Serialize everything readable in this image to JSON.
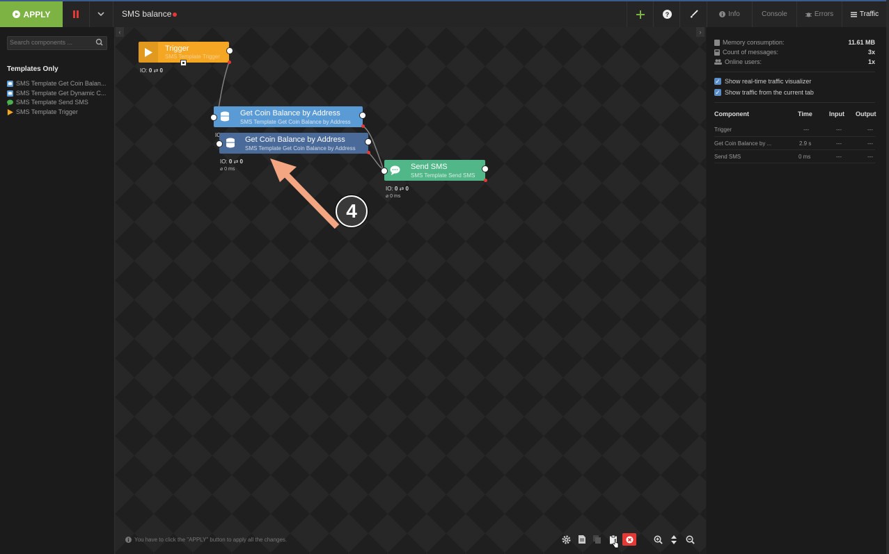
{
  "toolbar": {
    "apply_label": "APPLY",
    "flow_title": "SMS balance"
  },
  "right_tabs": [
    {
      "label": "Info",
      "icon": "info-icon"
    },
    {
      "label": "Console",
      "icon": ""
    },
    {
      "label": "Errors",
      "icon": "bug-icon"
    },
    {
      "label": "Traffic",
      "icon": "list-icon"
    }
  ],
  "sidebar": {
    "search_placeholder": "Search components ...",
    "heading": "Templates Only",
    "items": [
      {
        "label": "SMS Template Get Coin Balan...",
        "icon": "database-icon",
        "color": "#5b9bd5"
      },
      {
        "label": "SMS Template Get Dynamic C...",
        "icon": "database-icon",
        "color": "#5b9bd5"
      },
      {
        "label": "SMS Template Send SMS",
        "icon": "chat-icon",
        "color": "#4caf50"
      },
      {
        "label": "SMS Template Trigger",
        "icon": "play-icon",
        "color": "#f5a623"
      }
    ]
  },
  "nodes": {
    "trigger": {
      "title": "Trigger",
      "subtitle": "SMS Template Trigger",
      "io_prefix": "IO:",
      "io_in": "0",
      "io_arrow": "⇄",
      "io_out": "0",
      "color": "#f5a623"
    },
    "coin1": {
      "title": "Get Coin Balance by Address",
      "subtitle": "SMS Template Get Coin Balance by Address",
      "io_prefix": "IO:",
      "io_in": "0",
      "io_arrow": "⇄",
      "io_out": "0",
      "color": "#5b9bd5"
    },
    "coin2": {
      "title": "Get Coin Balance by Address",
      "subtitle": "SMS Template Get Coin Balance by Address",
      "io_prefix": "IO:",
      "io_in": "0",
      "io_arrow": "⇄",
      "io_out": "0",
      "avg": "⌀ 0 ms",
      "color": "#4a6a9a"
    },
    "sms": {
      "title": "Send SMS",
      "subtitle": "SMS Template Send SMS",
      "io_prefix": "IO:",
      "io_in": "0",
      "io_arrow": "⇄",
      "io_out": "0",
      "avg": "⌀ 0 ms",
      "color": "#52b788"
    }
  },
  "annotation": {
    "step": "4",
    "arrow_color": "#f4a582"
  },
  "status": {
    "hint": "You have to click the \"APPLY\" button to apply all the changes."
  },
  "stats": [
    {
      "label": "Memory consumption:",
      "value": "11.61 MB",
      "icon": "memory-icon"
    },
    {
      "label": "Count of messages:",
      "value": "3x",
      "icon": "calculator-icon"
    },
    {
      "label": "Online users:",
      "value": "1x",
      "icon": "users-icon"
    }
  ],
  "options": [
    {
      "label": "Show real-time traffic visualizer",
      "checked": true
    },
    {
      "label": "Show traffic from the current tab",
      "checked": true
    }
  ],
  "traffic": {
    "headers": [
      "Component",
      "Time",
      "Input",
      "Output"
    ],
    "rows": [
      {
        "component": "Trigger",
        "time": "---",
        "input": "---",
        "output": "---"
      },
      {
        "component": "Get Coin Balance by ...",
        "time": "2.9 s",
        "input": "---",
        "output": "---"
      },
      {
        "component": "Send SMS",
        "time": "0 ms",
        "input": "---",
        "output": "---"
      }
    ]
  },
  "colors": {
    "apply": "#7cb342",
    "accent_red": "#e53935",
    "panel_bg": "#1b1b1b"
  }
}
